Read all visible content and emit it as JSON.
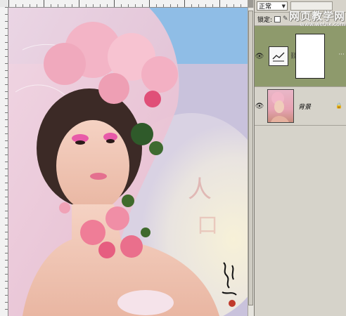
{
  "layers_panel": {
    "blend_mode": "正常",
    "lock_label": "锁定:",
    "layers": [
      {
        "name": "",
        "type": "adjustment",
        "visible": true
      },
      {
        "name": "背景",
        "type": "image",
        "visible": true,
        "locked": true
      }
    ]
  },
  "watermark": {
    "title": "网页教学网",
    "url": "www.webjx.com"
  },
  "colors": {
    "active_layer": "#8e9a6c",
    "panel_bg": "#d6d3ca",
    "sky": "#8fb9e2"
  },
  "icons": {
    "visibility": "eye-icon",
    "adjustment": "curves-icon",
    "link": "chain-link-icon",
    "lock": "lock-icon"
  }
}
